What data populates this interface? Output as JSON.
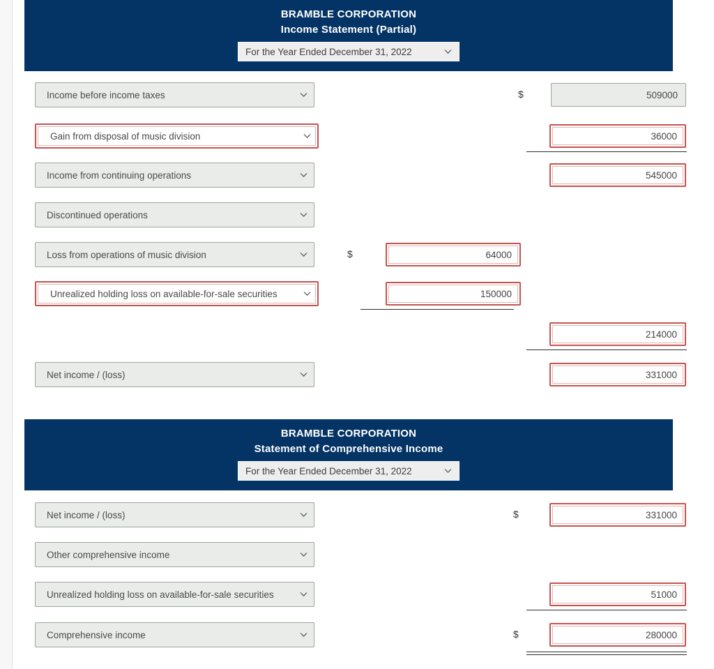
{
  "icons": {
    "chevron_down": "chevron-down-icon"
  },
  "colors": {
    "header_navy": "#043465",
    "error_red": "#c5534f",
    "select_gray": "#e9ece9",
    "page_white": "#ffffff"
  },
  "statements": [
    {
      "company": "BRAMBLE CORPORATION",
      "title": "Income Statement (Partial)",
      "period": "For the Year Ended December 31, 2022",
      "rows": [
        {
          "label": "Income before income taxes",
          "right_value": "509000",
          "right_dollar": "$",
          "right_readonly": true
        },
        {
          "label": "Gain from disposal of music division",
          "label_error": true,
          "right_value": "36000",
          "right_rule": true
        },
        {
          "label": "Income from continuing operations",
          "right_value": "545000"
        },
        {
          "label": "Discontinued operations"
        },
        {
          "label": "Loss from operations of music division",
          "mid_value": "64000",
          "mid_dollar": "$"
        },
        {
          "label": "Unrealized holding loss on available-for-sale securities",
          "label_error": true,
          "mid_value": "150000",
          "mid_rule": true
        },
        {
          "right_value": "214000",
          "right_rule": true
        },
        {
          "label": "Net income / (loss)",
          "right_value": "331000"
        }
      ]
    },
    {
      "company": "BRAMBLE CORPORATION",
      "title": "Statement of Comprehensive Income",
      "period": "For the Year Ended December 31, 2022",
      "rows": [
        {
          "label": "Net income / (loss)",
          "right_value": "331000",
          "right_dollar": "$"
        },
        {
          "label": "Other comprehensive income"
        },
        {
          "label": "Unrealized holding loss on available-for-sale securities",
          "right_value": "51000",
          "right_rule": true
        },
        {
          "label": "Comprehensive income",
          "right_value": "280000",
          "right_dollar": "$",
          "right_rule_double": true
        }
      ]
    }
  ]
}
